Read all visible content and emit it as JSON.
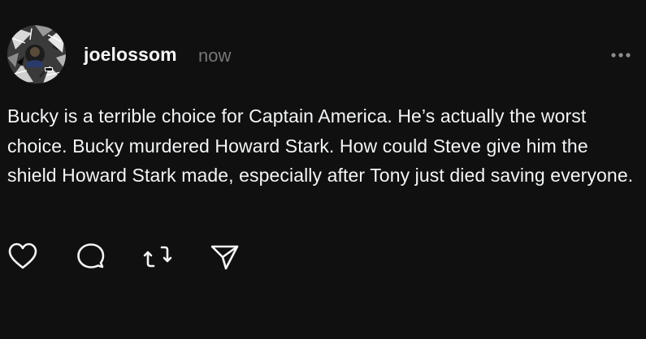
{
  "post": {
    "author": {
      "username": "joelossom",
      "avatar_icon": "profile-avatar-collage"
    },
    "timestamp": "now",
    "more_icon": "more-dots-icon",
    "text": "Bucky is a terrible choice for Captain America. He’s actually the worst choice. Bucky murdered Howard Stark. How could Steve give him the shield Howard Stark made, especially after Tony just died saving everyone.",
    "actions": [
      {
        "name": "like",
        "icon": "heart-icon"
      },
      {
        "name": "reply",
        "icon": "comment-bubble-icon"
      },
      {
        "name": "repost",
        "icon": "repost-icon"
      },
      {
        "name": "share",
        "icon": "send-icon"
      }
    ]
  },
  "colors": {
    "background": "#101010",
    "primary_text": "#f3f5f7",
    "secondary_text": "#777777",
    "icon": "#f3f5f7"
  }
}
